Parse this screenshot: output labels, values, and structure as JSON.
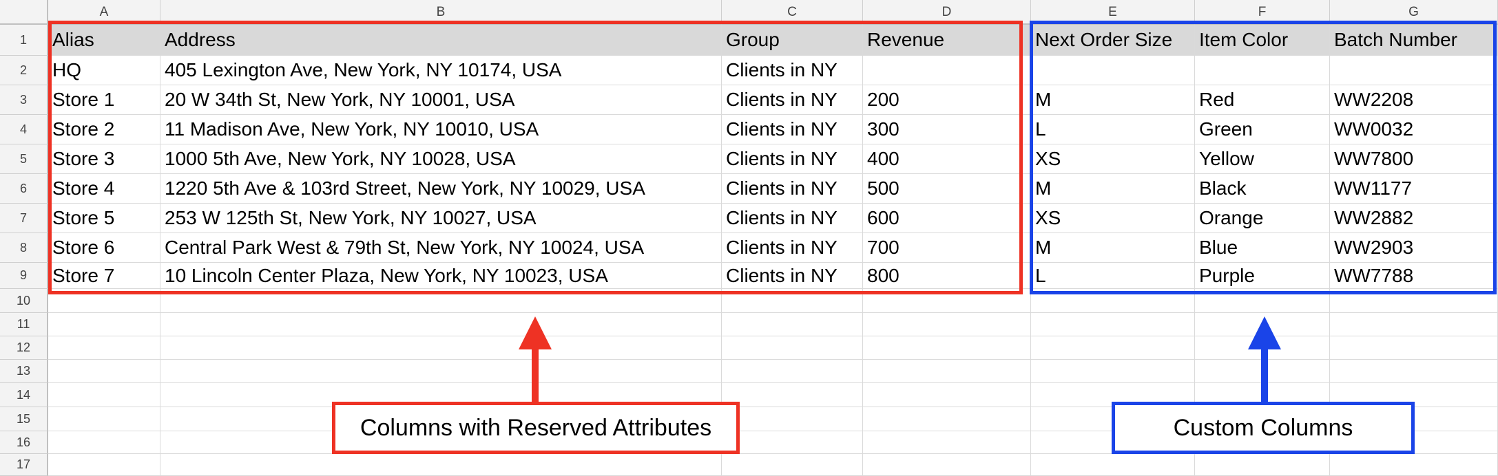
{
  "columns": [
    "A",
    "B",
    "C",
    "D",
    "E",
    "F",
    "G"
  ],
  "rows": [
    [
      "Alias",
      "Address",
      "Group",
      "Revenue",
      "Next Order Size",
      "Item Color",
      "Batch Number"
    ],
    [
      "HQ",
      "405 Lexington Ave, New York, NY 10174, USA",
      "Clients in NY",
      "",
      "",
      "",
      ""
    ],
    [
      "Store 1",
      "20 W 34th St, New York, NY 10001, USA",
      "Clients in NY",
      "200",
      "M",
      "Red",
      "WW2208"
    ],
    [
      "Store 2",
      "11 Madison Ave, New York, NY 10010, USA",
      "Clients in NY",
      "300",
      "L",
      "Green",
      "WW0032"
    ],
    [
      "Store 3",
      "1000 5th Ave, New York, NY 10028, USA",
      "Clients in NY",
      "400",
      "XS",
      "Yellow",
      "WW7800"
    ],
    [
      "Store 4",
      "1220 5th Ave & 103rd Street, New York, NY 10029, USA",
      "Clients in NY",
      "500",
      "M",
      "Black",
      "WW1177"
    ],
    [
      "Store 5",
      "253 W 125th St, New York, NY 10027, USA",
      "Clients in NY",
      "600",
      "XS",
      "Orange",
      "WW2882"
    ],
    [
      "Store 6",
      "Central Park West & 79th St, New York, NY 10024, USA",
      "Clients in NY",
      "700",
      "M",
      "Blue",
      "WW2903"
    ],
    [
      "Store 7",
      "10 Lincoln Center Plaza, New York, NY 10023, USA",
      "Clients in NY",
      "800",
      "L",
      "Purple",
      "WW7788"
    ],
    [
      "",
      "",
      "",
      "",
      "",
      "",
      ""
    ],
    [
      "",
      "",
      "",
      "",
      "",
      "",
      ""
    ],
    [
      "",
      "",
      "",
      "",
      "",
      "",
      ""
    ],
    [
      "",
      "",
      "",
      "",
      "",
      "",
      ""
    ],
    [
      "",
      "",
      "",
      "",
      "",
      "",
      ""
    ],
    [
      "",
      "",
      "",
      "",
      "",
      "",
      ""
    ],
    [
      "",
      "",
      "",
      "",
      "",
      "",
      ""
    ],
    [
      "",
      "",
      "",
      "",
      "",
      "",
      ""
    ]
  ],
  "row_numbers": [
    "1",
    "2",
    "3",
    "4",
    "5",
    "6",
    "7",
    "8",
    "9",
    "10",
    "11",
    "12",
    "13",
    "14",
    "15",
    "16",
    "17"
  ],
  "annotations": {
    "reserved": {
      "label": "Columns with Reserved Attributes",
      "color": "#ee3224"
    },
    "custom": {
      "label": "Custom Columns",
      "color": "#1a44e8"
    }
  }
}
